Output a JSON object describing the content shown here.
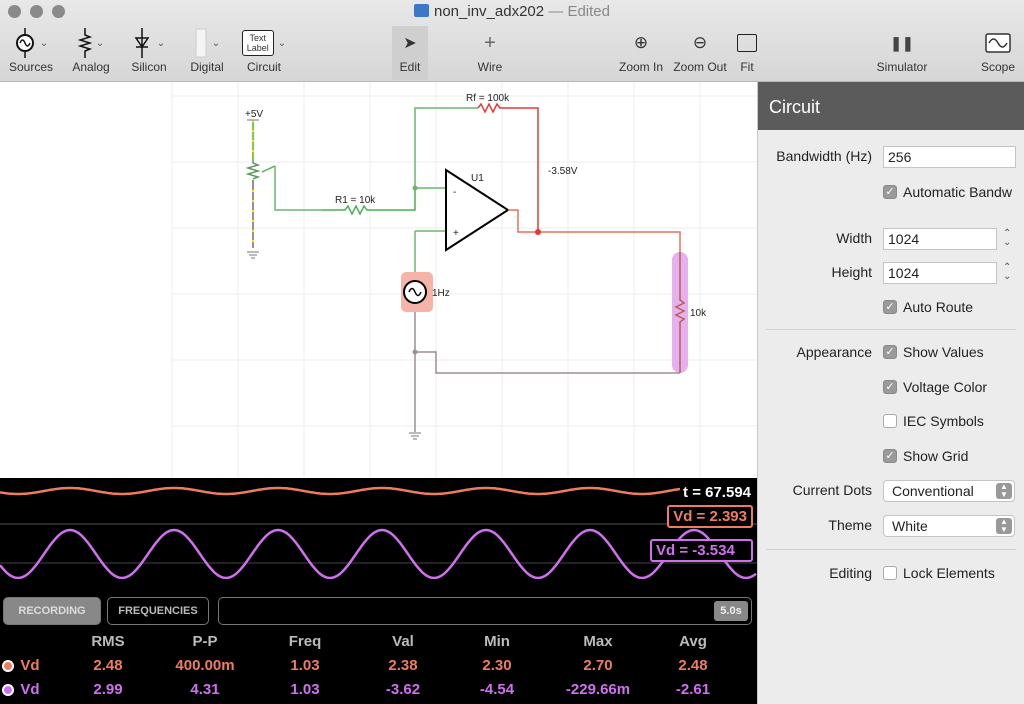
{
  "window": {
    "title": "non_inv_adx202",
    "status": "— Edited"
  },
  "toolbar": {
    "sources": "Sources",
    "analog": "Analog",
    "silicon": "Silicon",
    "digital": "Digital",
    "circuit": "Circuit",
    "text_label_icon": "Text Label",
    "edit": "Edit",
    "wire": "Wire",
    "zoom_in": "Zoom In",
    "zoom_out": "Zoom Out",
    "fit": "Fit",
    "simulator": "Simulator",
    "scope": "Scope"
  },
  "circuit": {
    "supply": "+5V",
    "r1": "R1 = 10k",
    "rf": "Rf = 100k",
    "opamp": "U1",
    "minus": "-",
    "plus": "+",
    "out_voltage": "-3.58V",
    "source_freq": "1Hz",
    "load": "10k",
    "colors": {
      "positive": "#4caf50",
      "negative": "#e53935",
      "neutral": "#9e8f8f",
      "probe1": "#f08070",
      "probe2": "#d070e0"
    }
  },
  "scope": {
    "time": "t = 67.594",
    "probe1_value": "Vd = 2.393",
    "probe2_value": "Vd = -3.534",
    "recording": "RECORDING",
    "frequencies": "FREQUENCIES",
    "window": "5.0s",
    "columns": [
      "RMS",
      "P-P",
      "Freq",
      "Val",
      "Min",
      "Max",
      "Avg"
    ],
    "rows": [
      {
        "name": "Vd",
        "color": "#f07c60",
        "values": [
          "2.48",
          "400.00m",
          "1.03",
          "2.38",
          "2.30",
          "2.70",
          "2.48"
        ]
      },
      {
        "name": "Vd",
        "color": "#d070f0",
        "values": [
          "2.99",
          "4.31",
          "1.03",
          "-3.62",
          "-4.54",
          "-229.66m",
          "-2.61"
        ]
      }
    ]
  },
  "panel": {
    "title": "Circuit",
    "bandwidth_label": "Bandwidth (Hz)",
    "bandwidth": "256",
    "auto_bandwidth": "Automatic Bandw",
    "width_label": "Width",
    "width": "1024",
    "height_label": "Height",
    "height": "1024",
    "auto_route": "Auto Route",
    "appearance_label": "Appearance",
    "show_values": "Show Values",
    "voltage_color": "Voltage Color",
    "iec_symbols": "IEC Symbols",
    "show_grid": "Show Grid",
    "current_dots_label": "Current Dots",
    "current_dots": "Conventional",
    "theme_label": "Theme",
    "theme": "White",
    "editing_label": "Editing",
    "lock_elements": "Lock Elements"
  }
}
